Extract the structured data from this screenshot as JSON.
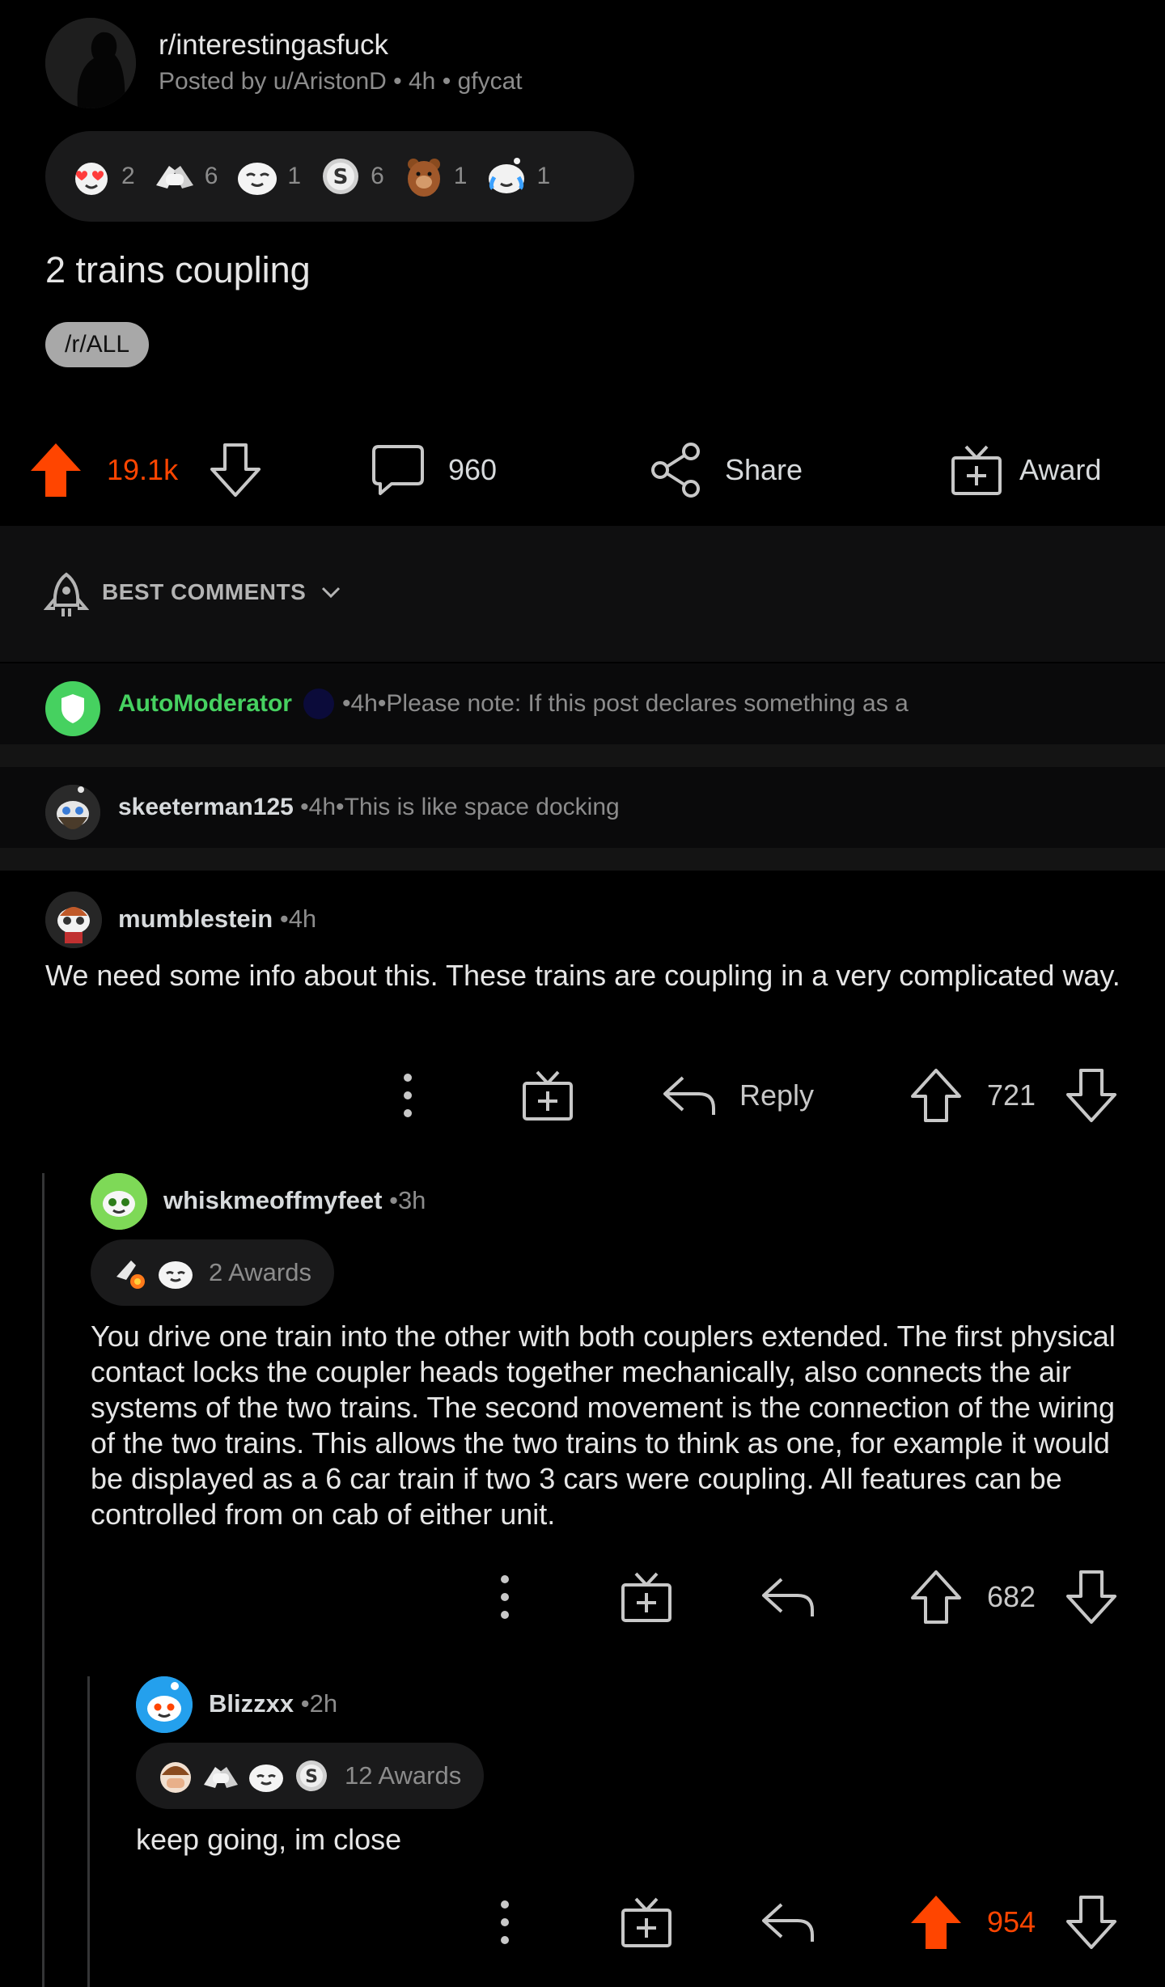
{
  "post": {
    "subreddit": "r/interestingasfuck",
    "author": "Posted by u/AristonD",
    "age": "4h",
    "source": "gfycat",
    "title": "2 trains coupling",
    "flair": "/r/ALL",
    "awards": [
      {
        "icon": "heart-eyes-award-icon",
        "count": "2"
      },
      {
        "icon": "hands-clasp-award-icon",
        "count": "6"
      },
      {
        "icon": "wholesome-award-icon",
        "count": "1"
      },
      {
        "icon": "silver-award-icon",
        "count": "6"
      },
      {
        "icon": "bear-award-icon",
        "count": "1"
      },
      {
        "icon": "snoo-tears-award-icon",
        "count": "1"
      }
    ],
    "votes": "19.1k",
    "comments": "960",
    "share_label": "Share",
    "award_label": "Award"
  },
  "sort": {
    "label": "BEST COMMENTS"
  },
  "collapsed_comments": [
    {
      "user": "AutoModerator",
      "age": "4h",
      "preview": "Please note:  If this post declares something as a"
    },
    {
      "user": "skeeterman125",
      "age": "4h",
      "preview": "This is like space docking"
    }
  ],
  "comments": [
    {
      "user": "mumblestein",
      "age": "4h",
      "body": "We need some info about this. These trains are coupling in a very complicated way.",
      "reply_label": "Reply",
      "votes": "721"
    },
    {
      "user": "whiskmeoffmyfeet",
      "age": "3h",
      "awards_label": "2 Awards",
      "body": "You drive one train into the other with both couplers extended. The first physical contact locks the coupler heads together mechanically, also connects the air systems of the two trains. The second movement is the connection of the wiring of the two trains. This allows the two trains to think as one, for example it would be displayed as a 6 car train if two 3 cars were coupling. All features can be controlled from on cab of either unit.",
      "votes": "682"
    },
    {
      "user": "Blizzxx",
      "age": "2h",
      "awards_label": "12 Awards",
      "body": "keep going, im close",
      "votes": "954"
    }
  ],
  "colors": {
    "upvote": "#ff4500",
    "automod": "#46d160",
    "background": "#000000"
  }
}
